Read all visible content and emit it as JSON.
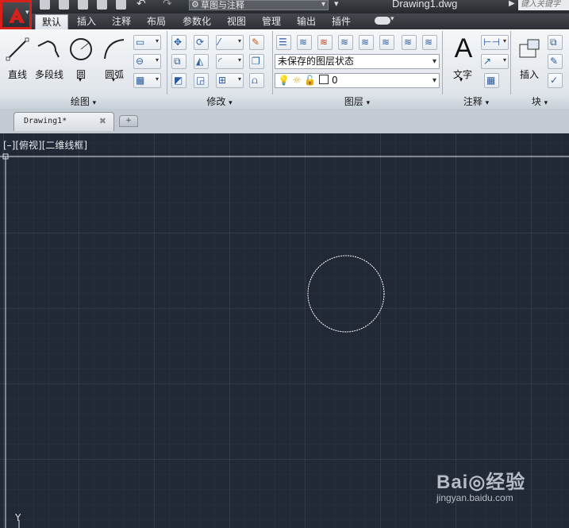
{
  "title_bar": {
    "workspace": "草图与注释",
    "document_title": "Drawing1.dwg",
    "search_placeholder": "键入关键字"
  },
  "ribbon_tabs": [
    "默认",
    "插入",
    "注释",
    "布局",
    "参数化",
    "视图",
    "管理",
    "输出",
    "插件"
  ],
  "active_tab": "默认",
  "draw_panel": {
    "title": "绘图",
    "tools": [
      "直线",
      "多段线",
      "圆",
      "圆弧"
    ]
  },
  "modify_panel": {
    "title": "修改"
  },
  "layers_panel": {
    "title": "图层",
    "layer_state": "未保存的图层状态",
    "current_layer": "0"
  },
  "annotation_panel": {
    "title": "注释",
    "text_label": "文字"
  },
  "block_panel": {
    "title": "块",
    "insert_label": "插入"
  },
  "file_tab": {
    "name": "Drawing1*",
    "close": "✖"
  },
  "viewport": {
    "label": "[–][俯视][二维线框]",
    "ucs_y": "Y"
  },
  "watermark": {
    "logo": "Bai◎经验",
    "url": "jingyan.baidu.com"
  },
  "colors": {
    "accent": "#d8201a",
    "canvas": "#212937",
    "circle": "#ffffff"
  }
}
